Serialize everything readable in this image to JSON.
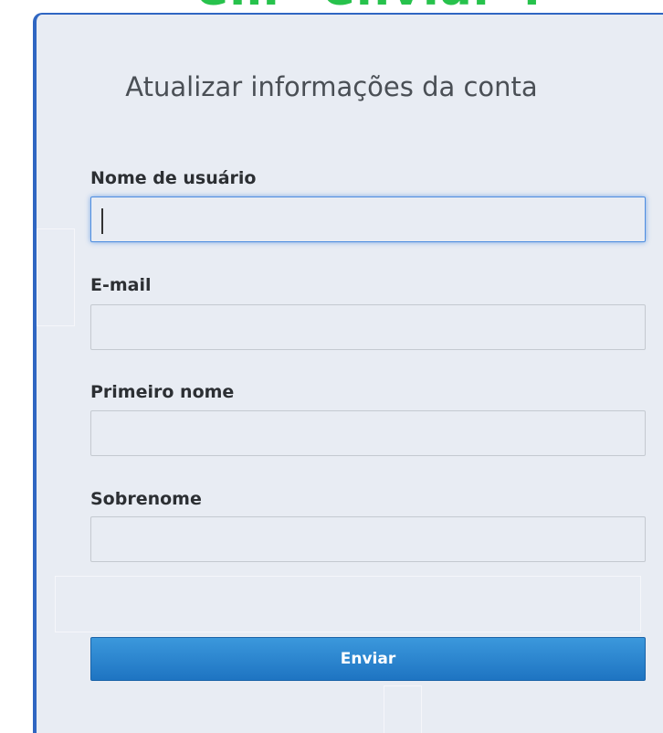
{
  "overlay": {
    "caption": "em \"enviar\"."
  },
  "form": {
    "title": "Atualizar informações da conta",
    "fields": [
      {
        "label": "Nome de usuário",
        "value": "",
        "placeholder": ""
      },
      {
        "label": "E-mail",
        "value": "",
        "placeholder": ""
      },
      {
        "label": "Primeiro nome",
        "value": "",
        "placeholder": ""
      },
      {
        "label": "Sobrenome",
        "value": "",
        "placeholder": ""
      }
    ],
    "submit_label": "Enviar"
  },
  "colors": {
    "panel_background": "#e8ecf3",
    "panel_border": "#2f66c2",
    "caption": "#27c24c",
    "button": "#2a86d0",
    "focus_ring": "#4d8de0"
  }
}
